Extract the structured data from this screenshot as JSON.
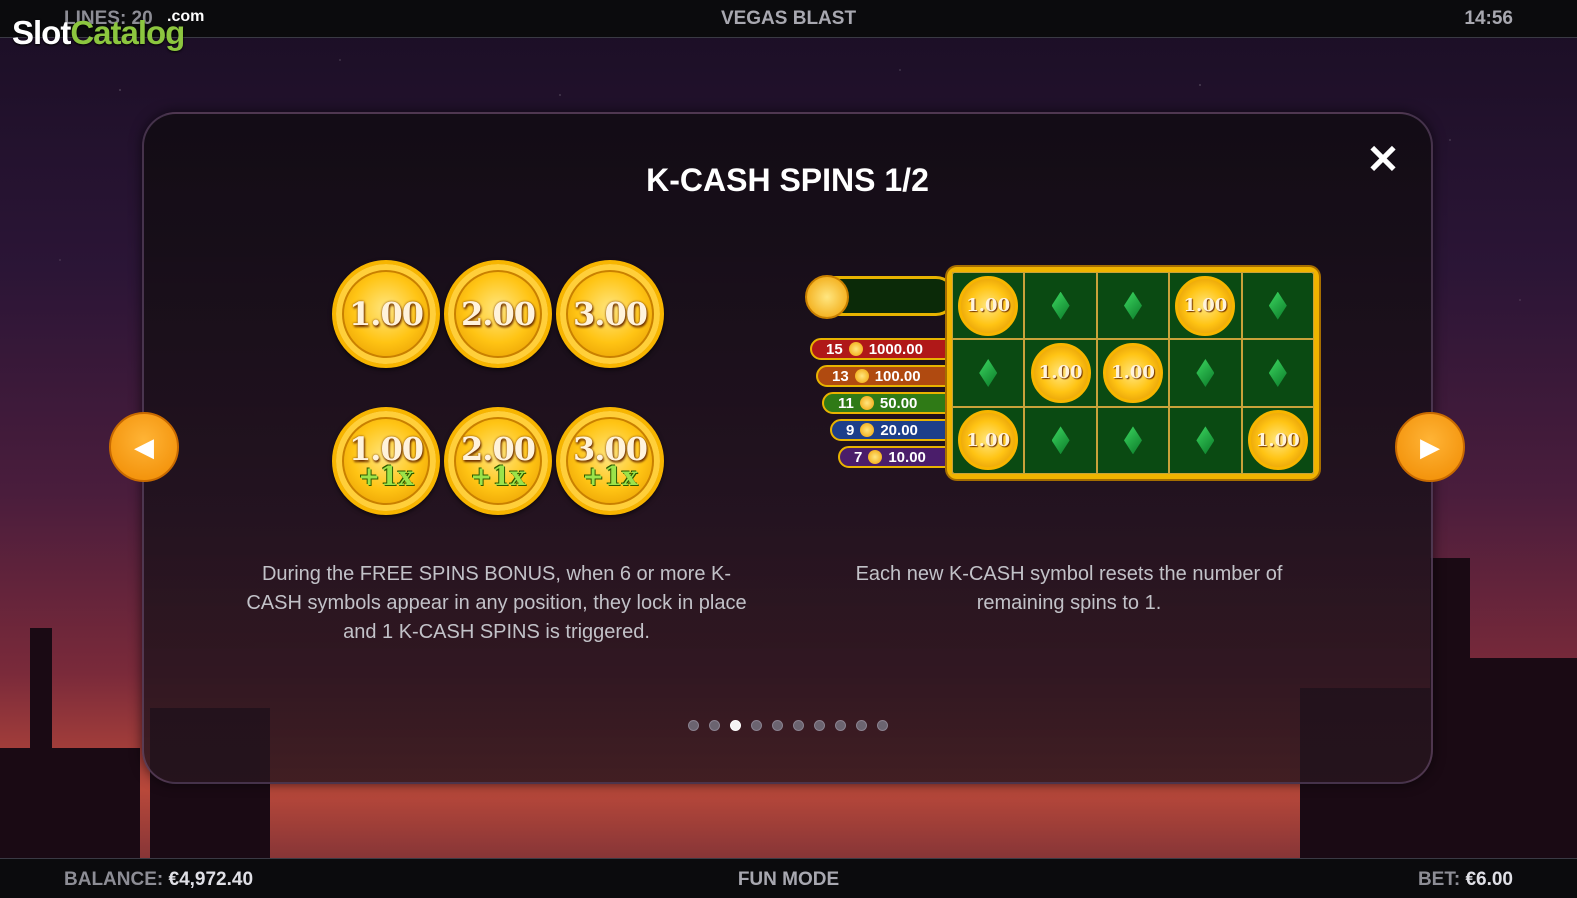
{
  "top_bar": {
    "lines": "LINES: 20",
    "game_title": "VEGAS BLAST",
    "clock": "14:56"
  },
  "watermark": {
    "part1": "Slot",
    "part2": "Catalog",
    "suffix": ".com"
  },
  "panel": {
    "title": "K-CASH SPINS 1/2",
    "close_label": "✕",
    "coins_row1": [
      "1.00",
      "2.00",
      "3.00"
    ],
    "coins_row2": [
      {
        "value": "1.00",
        "multiplier": "+1x"
      },
      {
        "value": "2.00",
        "multiplier": "+1x"
      },
      {
        "value": "3.00",
        "multiplier": "+1x"
      }
    ],
    "ladder": [
      {
        "count": "15",
        "prize": "1000.00",
        "color": "#b01818"
      },
      {
        "count": "13",
        "prize": "100.00",
        "color": "#b04a10"
      },
      {
        "count": "11",
        "prize": "50.00",
        "color": "#2f7a16"
      },
      {
        "count": "9",
        "prize": "20.00",
        "color": "#1d3f8a"
      },
      {
        "count": "7",
        "prize": "10.00",
        "color": "#4a1d6a"
      }
    ],
    "grid": [
      [
        "1.00",
        "gem",
        "gem",
        "1.00",
        "gem"
      ],
      [
        "gem",
        "1.00",
        "1.00",
        "gem",
        "gem"
      ],
      [
        "1.00",
        "gem",
        "gem",
        "gem",
        "1.00"
      ]
    ],
    "desc_left": "During the FREE SPINS BONUS, when 6 or more K-CASH symbols appear in any position, they lock in place and 1 K-CASH SPINS is triggered.",
    "desc_right": "Each new K-CASH symbol resets the number of remaining spins to 1.",
    "pager": {
      "total": 10,
      "active_index": 2
    }
  },
  "bottom_bar": {
    "balance_label": "BALANCE:",
    "balance_value": "€4,972.40",
    "mode": "FUN MODE",
    "bet_label": "BET:",
    "bet_value": "€6.00"
  },
  "colors": {
    "accent_orange": "#f08a00",
    "gold": "#f0b400",
    "grid_green": "#0a4a12"
  }
}
